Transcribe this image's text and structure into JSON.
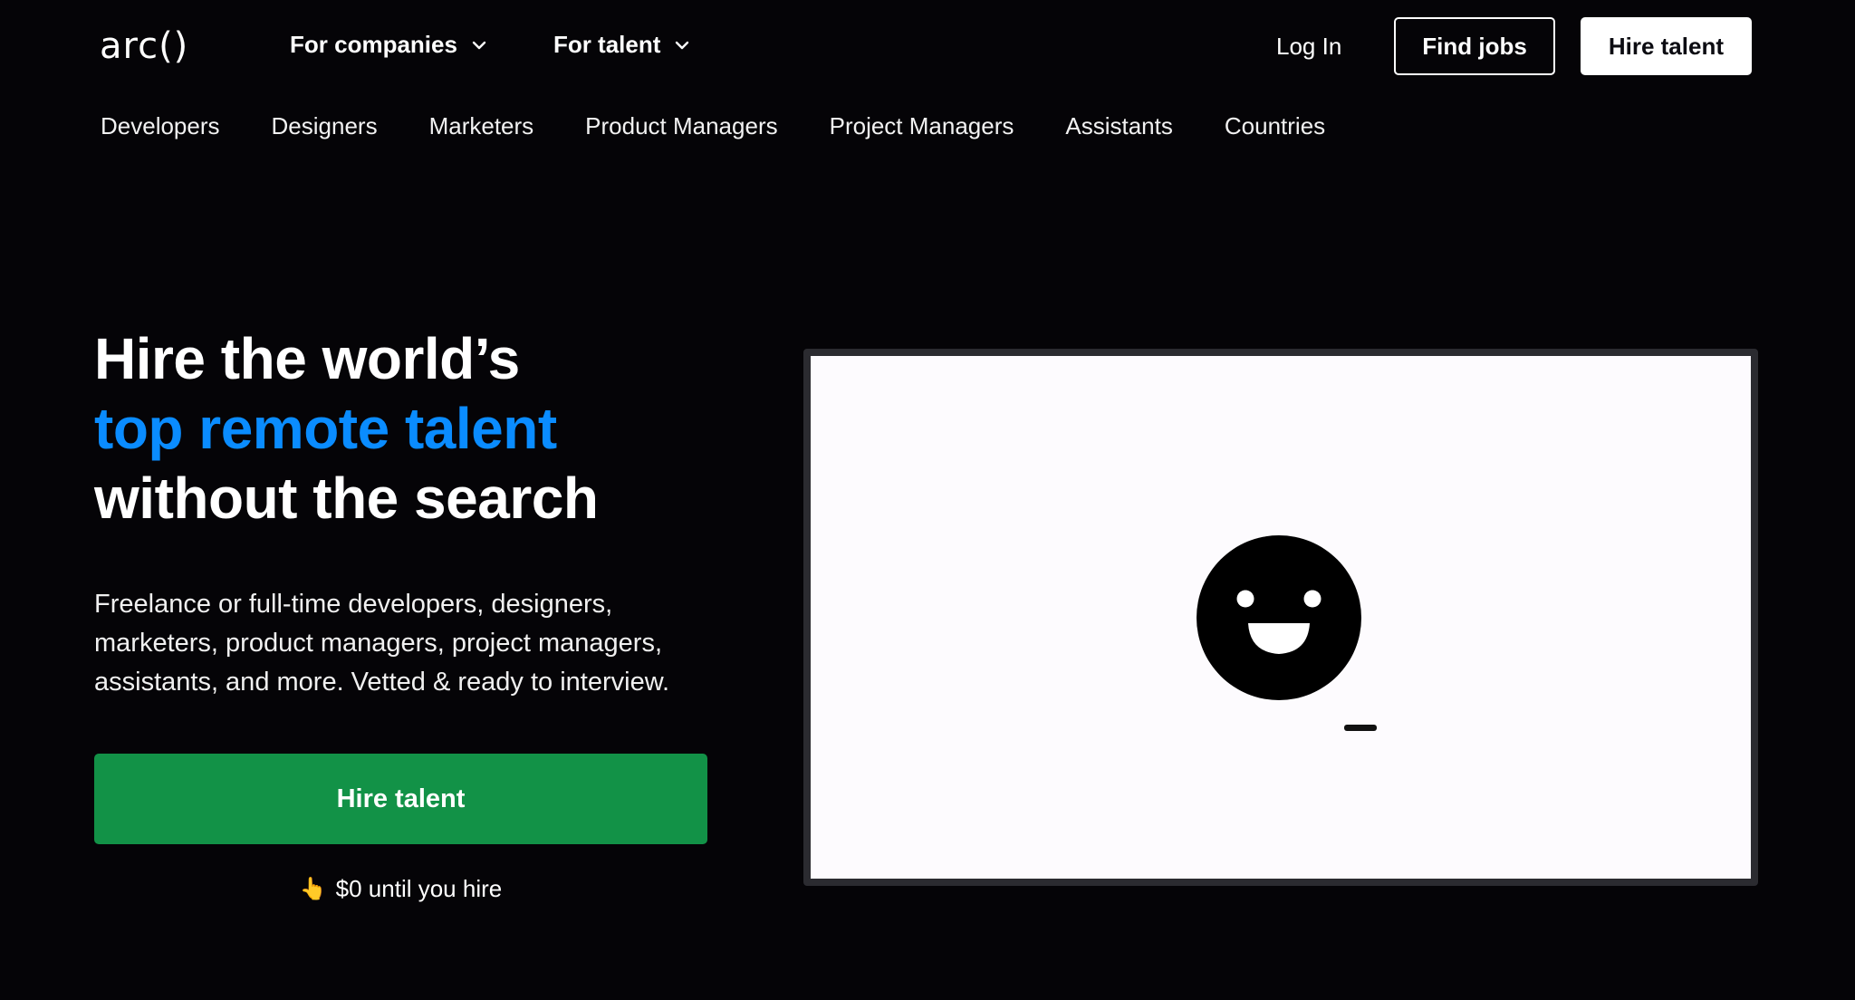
{
  "header": {
    "logo": "arc()",
    "nav": [
      {
        "label": "For companies",
        "icon": "chevron-down-icon"
      },
      {
        "label": "For talent",
        "icon": "chevron-down-icon"
      }
    ],
    "login": "Log In",
    "find_jobs": "Find jobs",
    "hire_talent": "Hire talent"
  },
  "categories": [
    "Developers",
    "Designers",
    "Marketers",
    "Product Managers",
    "Project Managers",
    "Assistants",
    "Countries"
  ],
  "hero": {
    "title_line1": "Hire the world’s",
    "title_line2": "top remote talent",
    "title_line3": "without the search",
    "subtitle": "Freelance or full-time developers, designers, marketers, product managers, project managers, assistants, and more. Vetted & ready to interview.",
    "cta": "Hire talent",
    "note_icon": "👆",
    "note": "$0 until you hire"
  },
  "media": {
    "icon": "smiley-face-icon"
  },
  "colors": {
    "accent": "#0a8cff",
    "cta": "#129247",
    "background": "#050407"
  }
}
